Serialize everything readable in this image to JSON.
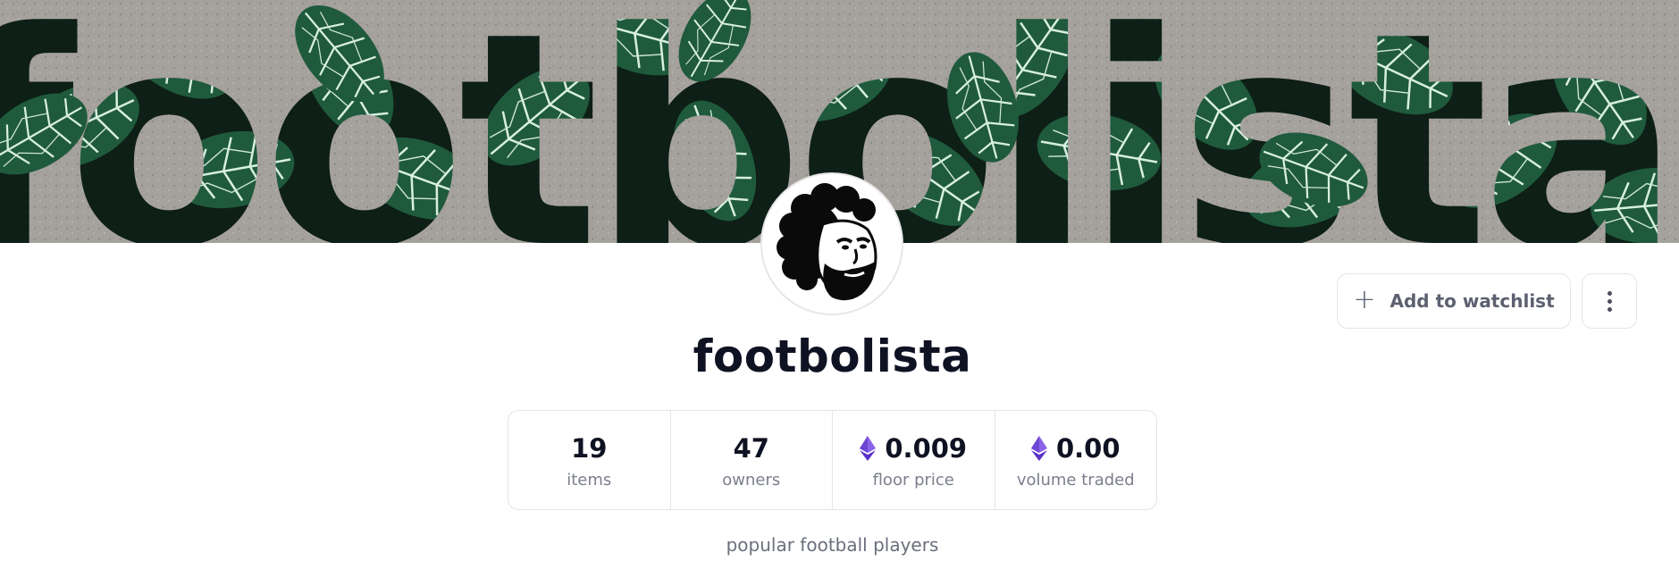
{
  "banner": {
    "text": "footbolista"
  },
  "avatar": {
    "alt": "footbolista avatar"
  },
  "actions": {
    "watchlist_label": "Add to watchlist",
    "watchlist_icon": "plus-icon",
    "more_icon": "kebab-menu-icon"
  },
  "collection": {
    "title": "footbolista",
    "description": "popular football players"
  },
  "stats": [
    {
      "value": "19",
      "label": "items",
      "currency_icon": ""
    },
    {
      "value": "47",
      "label": "owners",
      "currency_icon": ""
    },
    {
      "value": "0.009",
      "label": "floor price",
      "currency_icon": "ethereum-icon"
    },
    {
      "value": "0.00",
      "label": "volume traded",
      "currency_icon": "ethereum-icon"
    }
  ],
  "colors": {
    "eth_light": "#8a63e8",
    "eth_dark": "#5a32c8",
    "text_primary": "#0f1222",
    "text_secondary": "#7b7f8c"
  }
}
